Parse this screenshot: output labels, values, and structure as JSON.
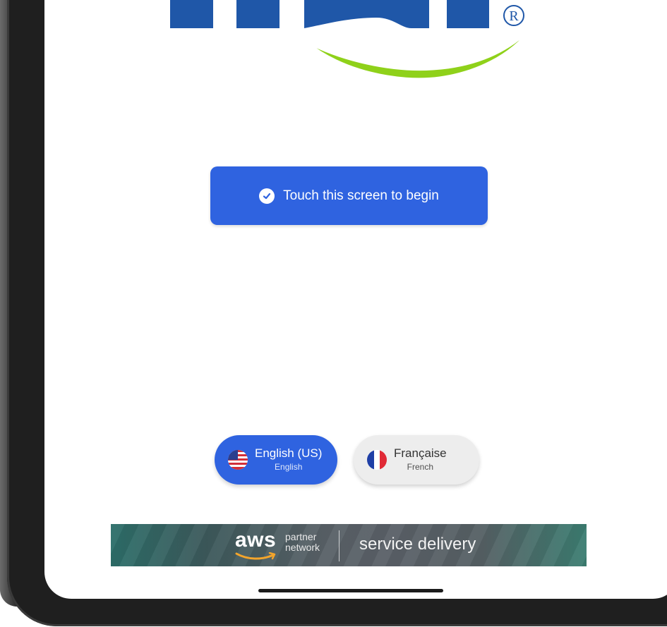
{
  "start": {
    "label": "Touch this screen to begin"
  },
  "languages": [
    {
      "label": "English (US)",
      "sublabel": "English"
    },
    {
      "label": "Française",
      "sublabel": "French"
    }
  ],
  "banner": {
    "aws": "aws",
    "partner_line1": "partner",
    "partner_line2": "network",
    "service": "service delivery"
  },
  "logo": {
    "mark": "®"
  },
  "colors": {
    "primary": "#2f63e0",
    "logo_blue": "#1f57a8",
    "logo_green": "#8fd11a"
  }
}
